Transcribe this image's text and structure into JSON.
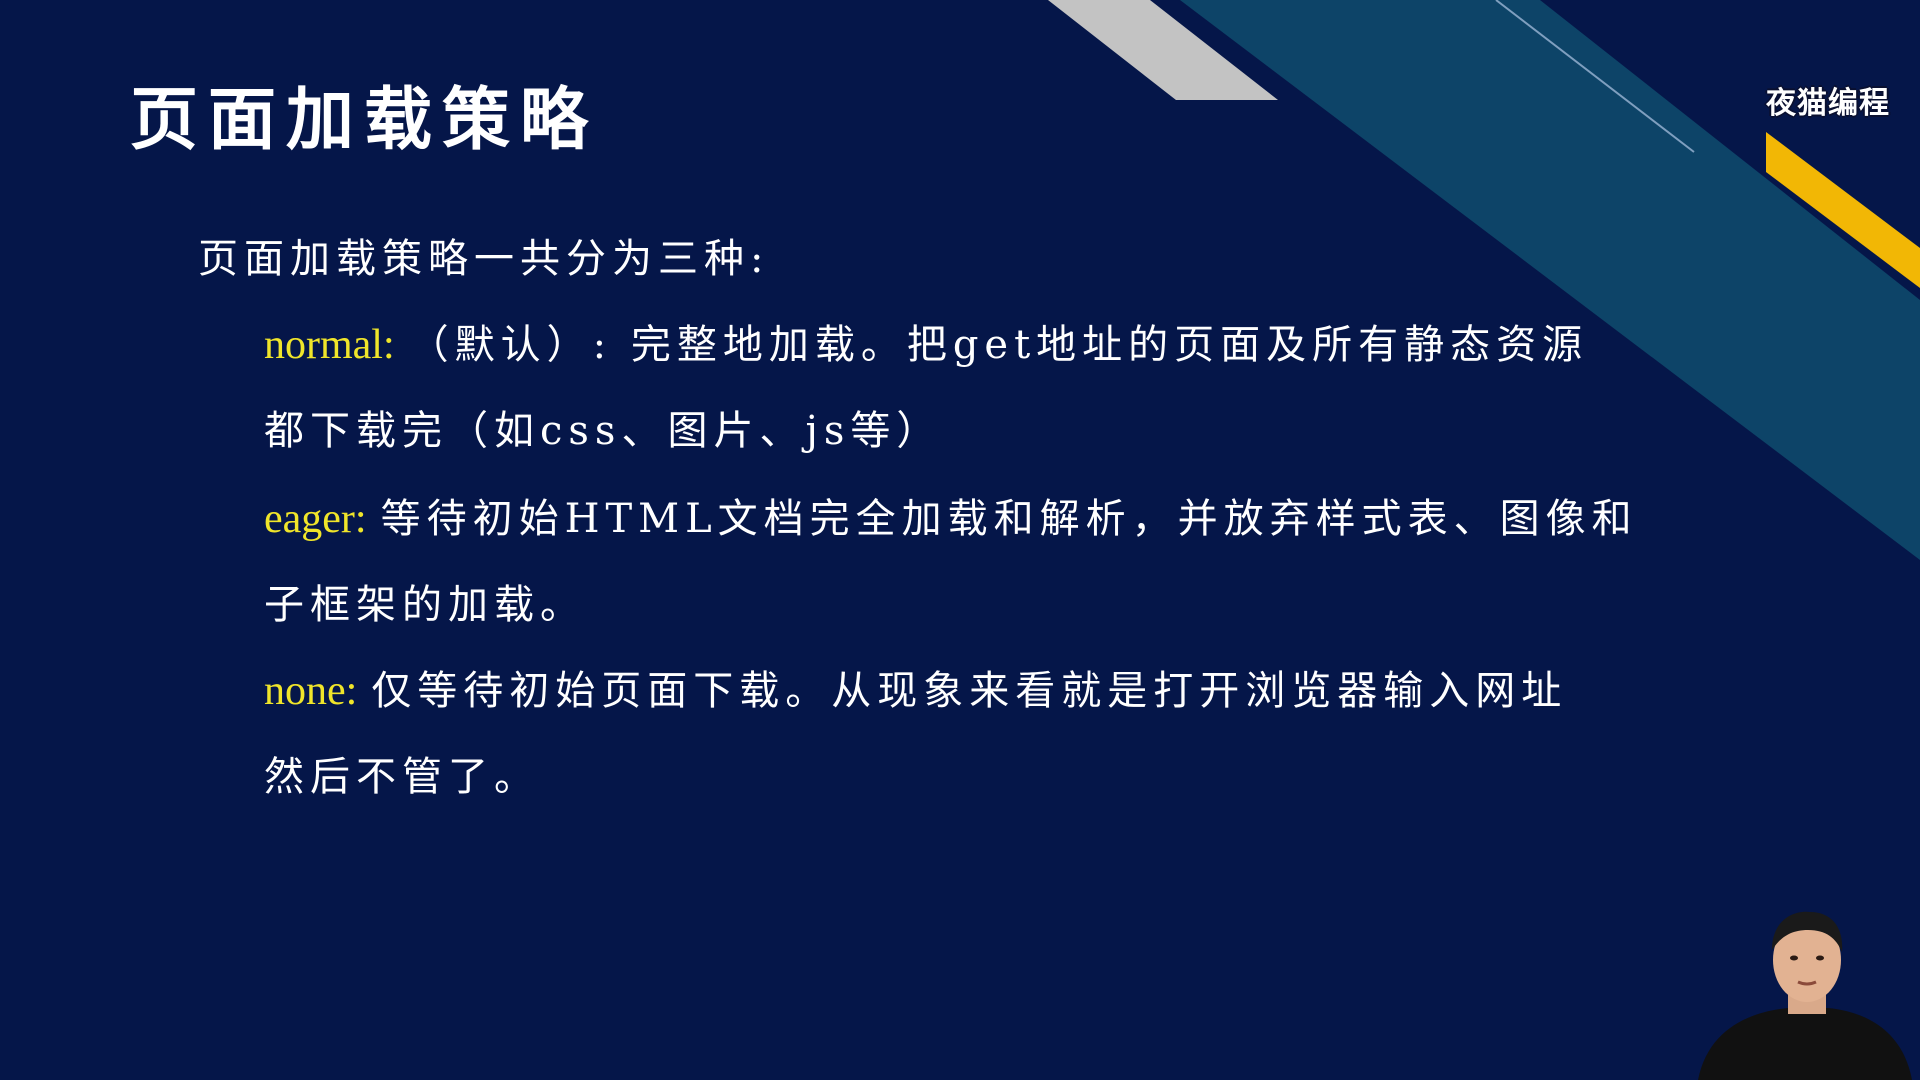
{
  "slide": {
    "title": "页面加载策略",
    "intro": "页面加载策略一共分为三种:",
    "strategies": [
      {
        "keyword": "normal:",
        "line1": "（默认）: 完整地加载。把get地址的页面及所有静态资源",
        "line2": "都下载完（如css、图片、js等）"
      },
      {
        "keyword": "eager:",
        "line1": "等待初始HTML文档完全加载和解析，并放弃样式表、图像和",
        "line2": "子框架的加载。"
      },
      {
        "keyword": "none:",
        "line1": "仅等待初始页面下载。从现象来看就是打开浏览器输入网址",
        "line2": "然后不管了。"
      }
    ]
  },
  "brand": {
    "logo_text": "夜猫编程"
  },
  "colors": {
    "background": "#051649",
    "keyword": "#f0e52a",
    "stripe_teal": "#0e4a6e",
    "stripe_gray": "#bfbfbf",
    "stripe_yellow": "#f2b705",
    "text": "#ffffff"
  }
}
